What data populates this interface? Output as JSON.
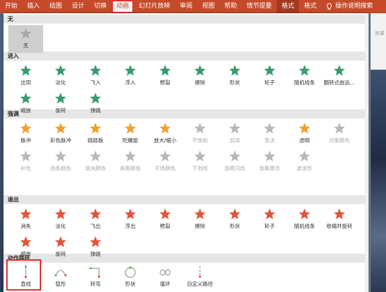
{
  "ribbon": {
    "tabs": [
      "开始",
      "插入",
      "绘图",
      "设计",
      "切换",
      "动画",
      "幻灯片放映",
      "审阅",
      "视图",
      "帮助",
      "情节提要",
      "格式",
      "格式"
    ],
    "active_tab": "动画",
    "tell_me": "操作说明搜索",
    "right_effect": "效果"
  },
  "colors": {
    "ribbon": "#c44a2a",
    "entrance": "#3a9a6e",
    "emphasis": "#f0a030",
    "exit": "#e0553a",
    "path": "#4d9a5c"
  },
  "sections": {
    "none": {
      "title": "无",
      "items": [
        "无"
      ]
    },
    "entrance": {
      "title": "进入",
      "items": [
        "出现",
        "淡化",
        "飞入",
        "浮入",
        "劈裂",
        "擦除",
        "形状",
        "轮子",
        "随机线条",
        "翻转式由远...",
        "缩放",
        "旋转",
        "弹跳"
      ]
    },
    "emphasis": {
      "title": "强调",
      "items": [
        "脉冲",
        "彩色脉冲",
        "跷跷板",
        "陀螺旋",
        "放大/缩小",
        "不饱和",
        "加深",
        "变淡",
        "透明",
        "对象颜色",
        "补色",
        "线条颜色",
        "填充颜色",
        "画笔颜色",
        "字体颜色",
        "下划线",
        "加粗闪烁",
        "加粗展示",
        "波浪形"
      ]
    },
    "exit": {
      "title": "退出",
      "items": [
        "消失",
        "淡化",
        "飞出",
        "浮出",
        "劈裂",
        "擦除",
        "形状",
        "轮子",
        "随机线条",
        "收缩并旋转",
        "缩放",
        "旋转",
        "弹跳"
      ]
    },
    "path": {
      "title": "动作路径",
      "items": [
        "直线",
        "弧形",
        "转弯",
        "形状",
        "循环",
        "自定义路径"
      ]
    }
  }
}
